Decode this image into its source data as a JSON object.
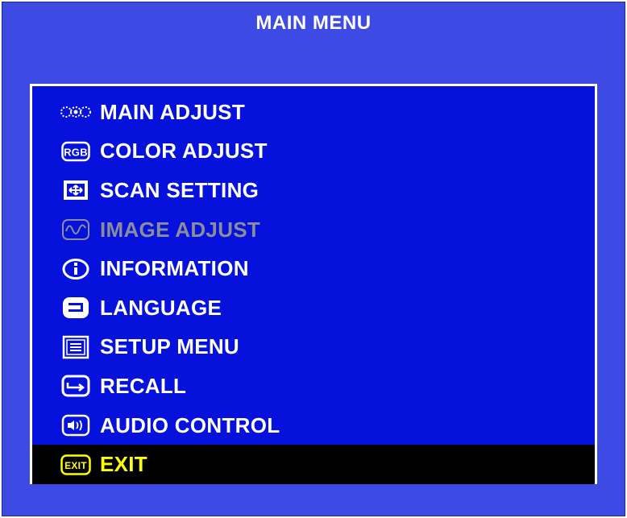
{
  "title": "MAIN MENU",
  "colors": {
    "background": "#3d4be4",
    "panel": "#0612dc",
    "text": "#ffffff",
    "disabled_text": "#8a8d9c",
    "selected_background": "#000000",
    "selected_text": "#ffff00"
  },
  "menu": {
    "items": [
      {
        "label": "MAIN ADJUST",
        "icon": "main-adjust-icon",
        "state": "normal"
      },
      {
        "label": "COLOR ADJUST",
        "icon": "rgb-icon",
        "state": "normal"
      },
      {
        "label": "SCAN SETTING",
        "icon": "scan-setting-icon",
        "state": "normal"
      },
      {
        "label": "IMAGE ADJUST",
        "icon": "waveform-icon",
        "state": "disabled"
      },
      {
        "label": "INFORMATION",
        "icon": "info-icon",
        "state": "normal"
      },
      {
        "label": "LANGUAGE",
        "icon": "language-icon",
        "state": "normal"
      },
      {
        "label": "SETUP MENU",
        "icon": "setup-menu-icon",
        "state": "normal"
      },
      {
        "label": "RECALL",
        "icon": "recall-icon",
        "state": "normal"
      },
      {
        "label": "AUDIO CONTROL",
        "icon": "audio-icon",
        "state": "normal"
      },
      {
        "label": "EXIT",
        "icon": "exit-icon",
        "state": "selected"
      }
    ]
  },
  "icon_text": {
    "rgb": "RGB",
    "exit": "EXIT"
  }
}
